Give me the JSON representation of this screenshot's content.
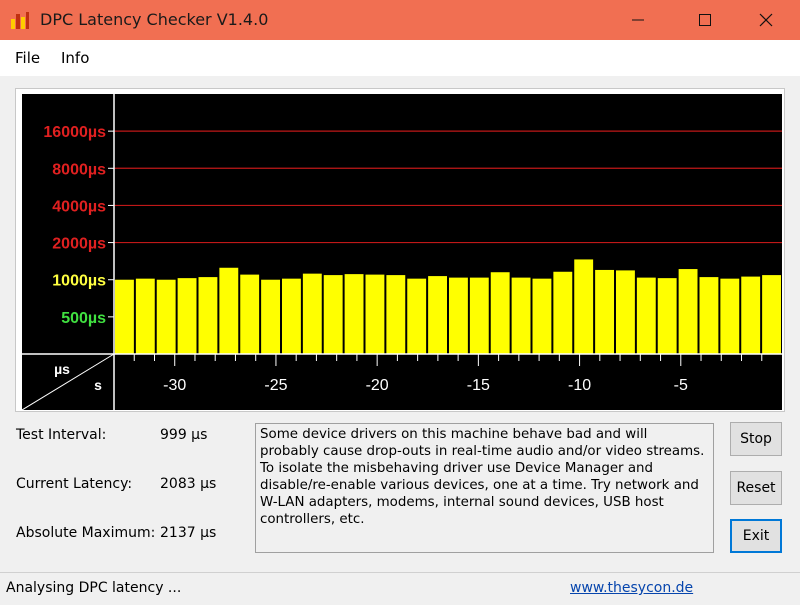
{
  "window": {
    "title": "DPC Latency Checker V1.4.0",
    "titlebar_color": "#f16f52"
  },
  "menu": [
    "File",
    "Info"
  ],
  "chart_data": {
    "type": "bar",
    "y_tick_labels": [
      {
        "label": "16000µs",
        "value": 16000,
        "color": "#e02020"
      },
      {
        "label": "8000µs",
        "value": 8000,
        "color": "#e02020"
      },
      {
        "label": "4000µs",
        "value": 4000,
        "color": "#e02020"
      },
      {
        "label": "2000µs",
        "value": 2000,
        "color": "#e02020"
      },
      {
        "label": "1000µs",
        "value": 1000,
        "color": "#ffff40"
      },
      {
        "label": "500µs",
        "value": 500,
        "color": "#40e040"
      }
    ],
    "x_tick_labels": [
      "-30",
      "-25",
      "-20",
      "-15",
      "-10",
      "-5"
    ],
    "x_ticks": [
      -30,
      -25,
      -20,
      -15,
      -10,
      -5
    ],
    "x_range": [
      -33,
      0
    ],
    "y_scale": "log",
    "y_range": [
      250,
      32000
    ],
    "corner_y_unit": "µs",
    "corner_x_unit": "s",
    "bar_color": "#ffff00",
    "background": "#000000",
    "grid_color": "#c01818",
    "values": [
      1000,
      1020,
      1000,
      1030,
      1050,
      1250,
      1100,
      1000,
      1020,
      1120,
      1090,
      1110,
      1100,
      1090,
      1020,
      1070,
      1040,
      1040,
      1150,
      1040,
      1020,
      1160,
      1460,
      1200,
      1190,
      1040,
      1030,
      1220,
      1050,
      1020,
      1060,
      1090
    ]
  },
  "info": {
    "test_interval_label": "Test Interval:",
    "test_interval_value": "999 µs",
    "current_latency_label": "Current Latency:",
    "current_latency_value": "2083 µs",
    "absolute_max_label": "Absolute Maximum:",
    "absolute_max_value": "2137 µs"
  },
  "message": "Some device drivers on this machine behave bad and will probably cause drop-outs in real-time audio and/or video streams. To isolate the misbehaving driver use Device Manager and disable/re-enable various devices, one at a time. Try network and W-LAN adapters, modems, internal sound devices, USB host controllers, etc.",
  "buttons": {
    "stop": "Stop",
    "reset": "Reset",
    "exit": "Exit"
  },
  "status": {
    "text": "Analysing DPC latency ...",
    "link": "www.thesycon.de"
  }
}
